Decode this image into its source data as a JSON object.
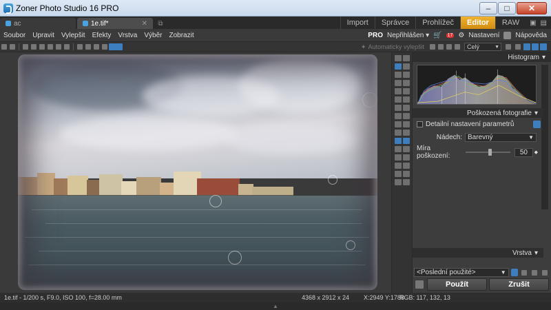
{
  "window": {
    "title": "Zoner Photo Studio 16 PRO",
    "minimize": "–",
    "maximize": "□",
    "close": "✕"
  },
  "tabs": [
    {
      "label": "ac"
    },
    {
      "label": "1e.tif*"
    }
  ],
  "modules": [
    "Import",
    "Správce",
    "Prohlížeč",
    "Editor",
    "RAW"
  ],
  "active_module": "Editor",
  "menu": {
    "items": [
      "Soubor",
      "Upravit",
      "Vylepšit",
      "Efekty",
      "Vrstva",
      "Výběr",
      "Zobrazit"
    ],
    "pro": "PRO",
    "user": "Nepřihlášen",
    "badge": "17",
    "settings": "Nastavení",
    "help": "Nápověda"
  },
  "toolbar": {
    "auto_enhance": "Automaticky vylepšit",
    "zoom": "Celý"
  },
  "panel": {
    "histogram_title": "Histogram",
    "effect_title": "Poškozená fotografie",
    "detail_checkbox": "Detailní nastavení parametrů",
    "tint_label": "Nádech:",
    "tint_value": "Barevný",
    "damage_label": "Míra poškození:",
    "damage_value": "50",
    "layer_title": "Vrstva",
    "preset_value": "<Poslední použité>",
    "apply": "Použít",
    "cancel": "Zrušit"
  },
  "status": {
    "file_info": "1e.tif - 1/200 s, F9.0, ISO 100, f=28.00 mm",
    "dimensions": "4368 x 2912 x 24",
    "coords": "X:2949 Y:1788",
    "rgb": "RGB: 117, 132, 13"
  },
  "colors": {
    "accent": "#e09a1a",
    "blue": "#3d7ebf"
  }
}
